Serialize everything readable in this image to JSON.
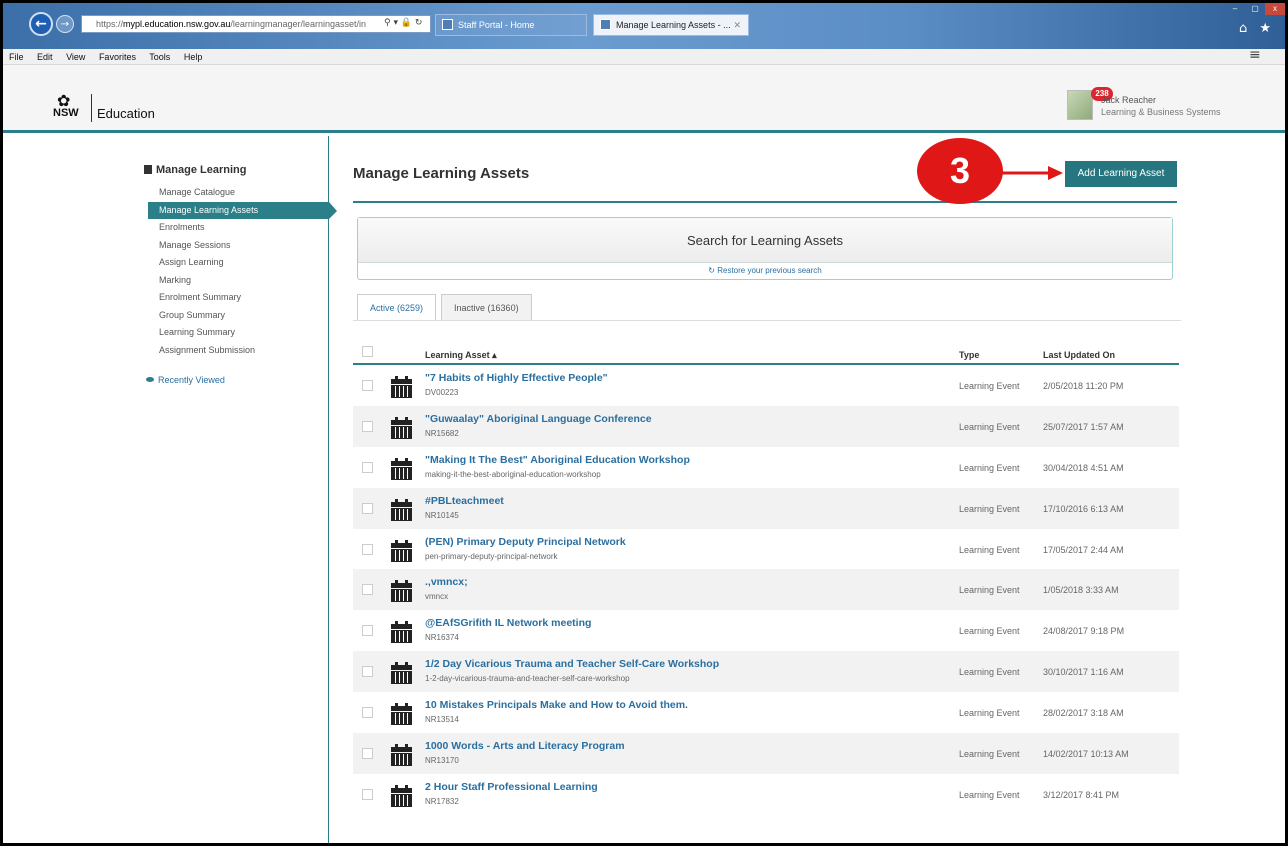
{
  "browser": {
    "url_prefix": "https://",
    "url_host": "mypl.education.nsw.gov.au",
    "url_path": "/learningmanager/learningasset/in",
    "address_icons": "⚲ ▾ 🔒 ↻",
    "tabs": [
      {
        "label": "Staff Portal - Home"
      },
      {
        "label": "Manage Learning Assets - ...",
        "close": "✕"
      }
    ],
    "window_controls": [
      "–",
      "▢",
      "x"
    ],
    "chrome_icons": "⌂ ★",
    "menu": [
      "File",
      "Edit",
      "View",
      "Favorites",
      "Tools",
      "Help"
    ]
  },
  "header": {
    "logo_text": "NSW",
    "logo_name": "Education",
    "notification_count": "238",
    "user_name": "Jack Reacher",
    "user_role": "Learning & Business Systems",
    "menu_icon": "≡"
  },
  "sidebar": {
    "heading": "Manage Learning",
    "items": [
      {
        "label": "Manage Catalogue"
      },
      {
        "label": "Manage Learning Assets"
      },
      {
        "label": "Enrolments"
      },
      {
        "label": "Manage Sessions"
      },
      {
        "label": "Assign Learning"
      },
      {
        "label": "Marking"
      },
      {
        "label": "Enrolment Summary"
      },
      {
        "label": "Group Summary"
      },
      {
        "label": "Learning Summary"
      },
      {
        "label": "Assignment Submission"
      }
    ],
    "recently_viewed": "Recently Viewed"
  },
  "main": {
    "title": "Manage Learning Assets",
    "add_button": "Add Learning Asset",
    "step_number": "3",
    "search_title": "Search for Learning Assets",
    "restore_link": "Restore your previous search",
    "restore_icon": "↻",
    "tabs": [
      {
        "label": "Active (6259)"
      },
      {
        "label": "Inactive (16360)"
      }
    ],
    "columns": {
      "asset": "Learning Asset ▴",
      "type": "Type",
      "updated": "Last Updated On"
    },
    "rows": [
      {
        "title": "\"7 Habits of Highly Effective People\"",
        "code": "DV00223",
        "type": "Learning Event",
        "updated": "2/05/2018 11:20 PM"
      },
      {
        "title": "\"Guwaalay\" Aboriginal Language Conference",
        "code": "NR15682",
        "type": "Learning Event",
        "updated": "25/07/2017 1:57 AM"
      },
      {
        "title": "\"Making It The Best\" Aboriginal Education Workshop",
        "code": "making-it-the-best-aboriginal-education-workshop",
        "type": "Learning Event",
        "updated": "30/04/2018 4:51 AM"
      },
      {
        "title": "#PBLteachmeet",
        "code": "NR10145",
        "type": "Learning Event",
        "updated": "17/10/2016 6:13 AM"
      },
      {
        "title": "(PEN) Primary Deputy Principal Network",
        "code": "pen-primary-deputy-principal-network",
        "type": "Learning Event",
        "updated": "17/05/2017 2:44 AM"
      },
      {
        "title": ".,vmncx;",
        "code": "vmncx",
        "type": "Learning Event",
        "updated": "1/05/2018 3:33 AM"
      },
      {
        "title": "@EAfSGrifith IL Network meeting",
        "code": "NR16374",
        "type": "Learning Event",
        "updated": "24/08/2017 9:18 PM"
      },
      {
        "title": "1/2 Day Vicarious Trauma and Teacher Self-Care Workshop",
        "code": "1-2-day-vicarious-trauma-and-teacher-self-care-workshop",
        "type": "Learning Event",
        "updated": "30/10/2017 1:16 AM"
      },
      {
        "title": "10 Mistakes Principals Make and How to Avoid them.",
        "code": "NR13514",
        "type": "Learning Event",
        "updated": "28/02/2017 3:18 AM"
      },
      {
        "title": "1000 Words - Arts and Literacy Program",
        "code": "NR13170",
        "type": "Learning Event",
        "updated": "14/02/2017 10:13 AM"
      },
      {
        "title": "2 Hour Staff Professional Learning",
        "code": "NR17832",
        "type": "Learning Event",
        "updated": "3/12/2017 8:41 PM"
      }
    ]
  },
  "colors": {
    "teal": "#2a7f88",
    "button": "#25767f",
    "link": "#2a6fa0",
    "annotation_red": "#e01717",
    "badge_red": "#d9262f"
  }
}
